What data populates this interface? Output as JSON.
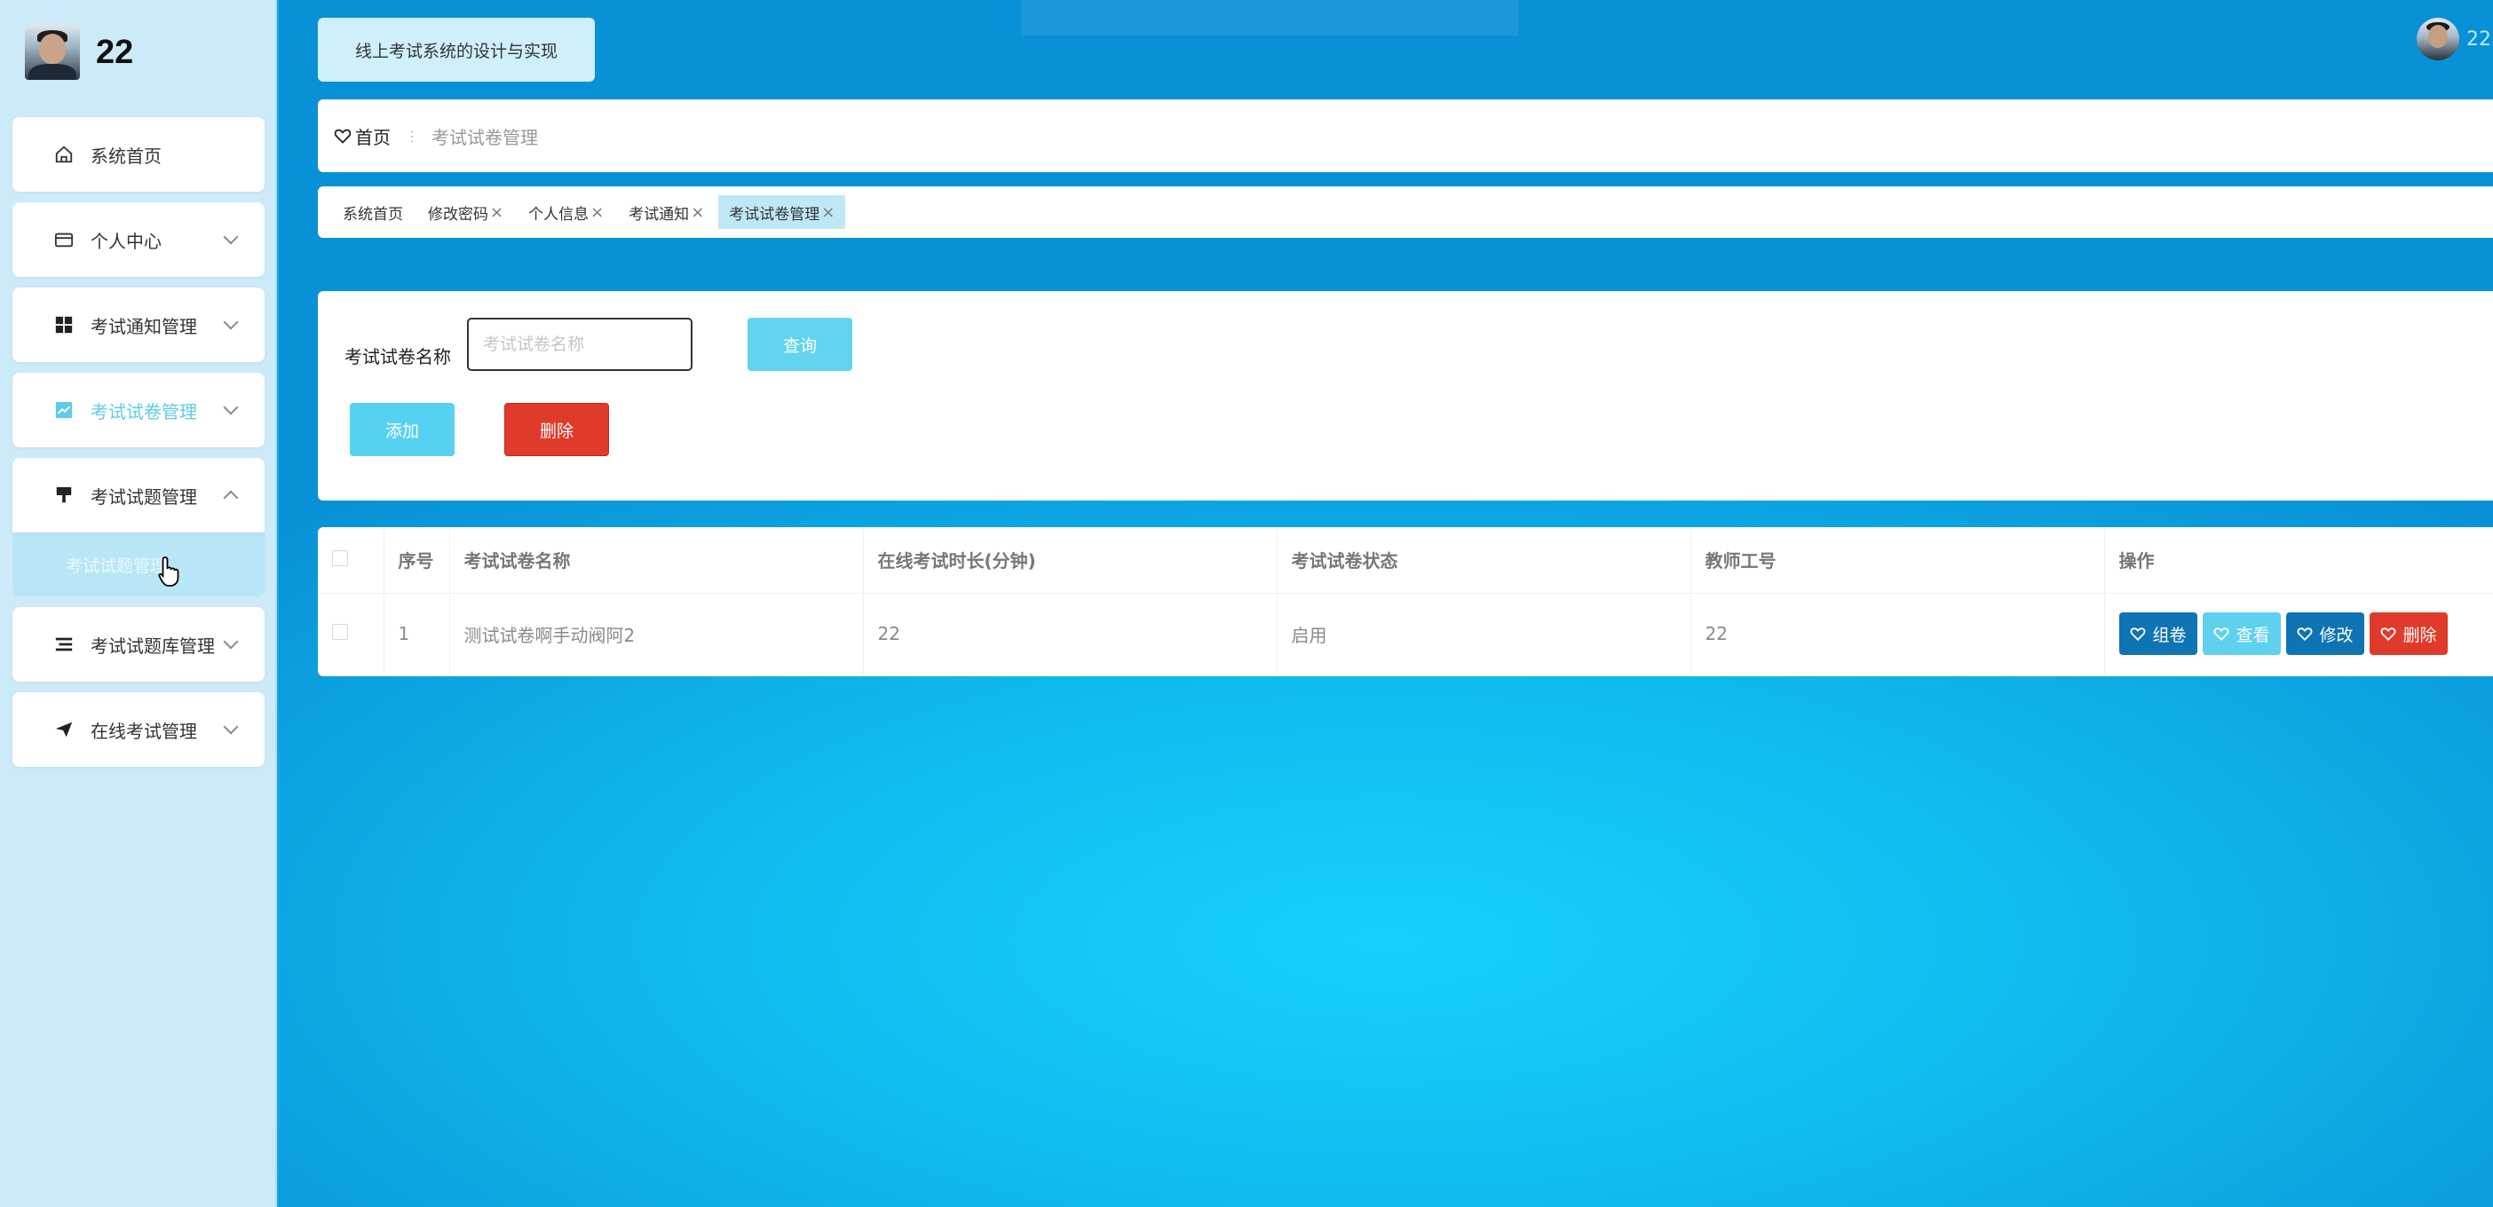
{
  "sidebar": {
    "username": "22",
    "nav_items": [
      {
        "label": "系统首页",
        "icon": "home-icon"
      },
      {
        "label": "个人中心",
        "icon": "card-icon"
      },
      {
        "label": "考试通知管理",
        "icon": "grid-icon"
      },
      {
        "label": "考试试卷管理",
        "icon": "chart-icon"
      },
      {
        "label": "考试试题管理",
        "icon": "brush-icon"
      },
      {
        "label": "考试试题库管理",
        "icon": "list-icon"
      },
      {
        "label": "在线考试管理",
        "icon": "send-icon"
      }
    ],
    "sub_item": "考试试题管理"
  },
  "header": {
    "system_title": "线上考试系统的设计与实现",
    "user_name": "22"
  },
  "breadcrumb": {
    "home": "首页",
    "separator": "⋮",
    "current": "考试试卷管理"
  },
  "tabs": [
    {
      "label": "系统首页",
      "closable": false
    },
    {
      "label": "修改密码",
      "closable": true
    },
    {
      "label": "个人信息",
      "closable": true
    },
    {
      "label": "考试通知",
      "closable": true
    },
    {
      "label": "考试试卷管理",
      "closable": true,
      "active": true
    }
  ],
  "tab_close_glyph": "×",
  "search": {
    "label": "考试试卷名称",
    "placeholder": "考试试卷名称",
    "value": "",
    "query_label": "查询",
    "add_label": "添加",
    "delete_label": "删除"
  },
  "table": {
    "headers": [
      "序号",
      "考试试卷名称",
      "在线考试时长(分钟)",
      "考试试卷状态",
      "教师工号",
      "操作"
    ],
    "rows": [
      {
        "index": "1",
        "name": "测试试卷啊手动阀阿2",
        "duration": "22",
        "status": "启用",
        "teacher_id": "22"
      }
    ],
    "row_actions": [
      "组卷",
      "查看",
      "修改",
      "删除"
    ]
  },
  "colors": {
    "accent": "#5fcbe8",
    "danger": "#e03a2a",
    "primary_dark": "#0f74b3",
    "sidebar_bg": "#cdeaf8"
  }
}
